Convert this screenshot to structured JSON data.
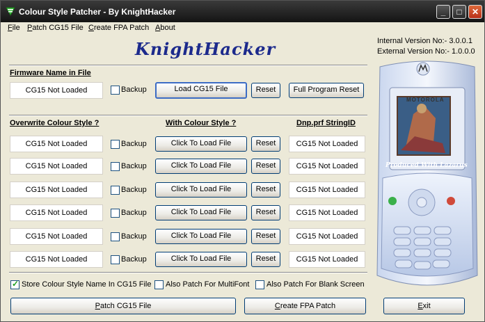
{
  "window": {
    "title": "Colour Style Patcher - By KnightHacker",
    "min": "_",
    "max": "□",
    "close": "✕"
  },
  "menu": [
    {
      "label": "File",
      "ul": "F",
      "rest": "ile"
    },
    {
      "label": "Patch CG15 File",
      "ul": "P",
      "rest": "atch CG15 File"
    },
    {
      "label": "Create FPA Patch",
      "ul": "C",
      "rest": "reate FPA Patch"
    },
    {
      "label": "About",
      "ul": "A",
      "rest": "bout"
    }
  ],
  "logo": "KnightHacker",
  "version": {
    "internal": "Internal  Version No:- 3.0.0.1",
    "external": "External Version No:- 1.0.0.0"
  },
  "firmware": {
    "heading": "Firmware Name in File",
    "field": "CG15 Not Loaded",
    "backup": "Backup",
    "load": "Load CG15 File",
    "reset": "Reset",
    "full_reset": "Full Program Reset"
  },
  "columns": {
    "overwrite": "Overwrite Colour Style ?",
    "with": "With Colour Style ?",
    "dnp": "Dnp.prf StringID"
  },
  "rows": [
    {
      "left": "CG15 Not Loaded",
      "backup": "Backup",
      "load": "Click To Load File",
      "reset": "Reset",
      "dnp": "CG15 Not Loaded"
    },
    {
      "left": "CG15 Not Loaded",
      "backup": "Backup",
      "load": "Click To Load File",
      "reset": "Reset",
      "dnp": "CG15 Not Loaded"
    },
    {
      "left": "CG15 Not Loaded",
      "backup": "Backup",
      "load": "Click To Load File",
      "reset": "Reset",
      "dnp": "CG15 Not Loaded"
    },
    {
      "left": "CG15 Not Loaded",
      "backup": "Backup",
      "load": "Click To Load File",
      "reset": "Reset",
      "dnp": "CG15 Not Loaded"
    },
    {
      "left": "CG15 Not Loaded",
      "backup": "Backup",
      "load": "Click To Load File",
      "reset": "Reset",
      "dnp": "CG15 Not Loaded"
    },
    {
      "left": "CG15 Not Loaded",
      "backup": "Backup",
      "load": "Click To Load File",
      "reset": "Reset",
      "dnp": "CG15 Not Loaded"
    }
  ],
  "options": {
    "store": {
      "label": "Store Colour Style Name In CG15 File",
      "checked": true
    },
    "multifont": {
      "label": "Also Patch For MultiFont",
      "checked": false
    },
    "blank": {
      "label": "Also Patch For Blank Screen",
      "checked": false
    }
  },
  "actions": {
    "patch": {
      "ul": "P",
      "rest": "atch CG15 File"
    },
    "fpa": {
      "ul": "C",
      "rest": "reate FPA Patch"
    },
    "exit": {
      "ul": "E",
      "rest": "xit"
    }
  },
  "phone": {
    "brand": "MOTOROLA",
    "caption": "Produced With Lazarus"
  }
}
